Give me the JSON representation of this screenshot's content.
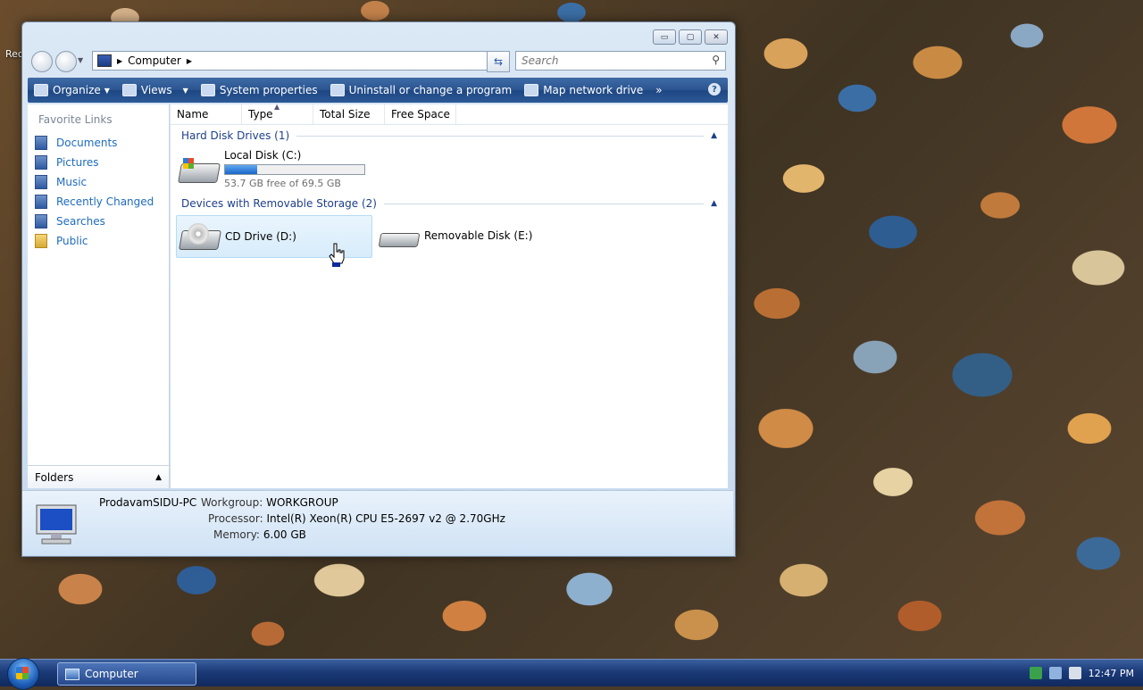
{
  "desktop": {
    "label_fragment": "Rec"
  },
  "window": {
    "caption": {
      "minimize": "▭",
      "maximize": "▢",
      "close": "✕"
    },
    "address": {
      "crumbs": [
        "Computer"
      ]
    },
    "search": {
      "placeholder": "Search"
    },
    "toolbar": {
      "items": [
        {
          "label": "Organize",
          "icon": "organize-icon"
        },
        {
          "label": "Views",
          "icon": "views-icon"
        },
        {
          "label": "System properties",
          "icon": "system-properties-icon"
        },
        {
          "label": "Uninstall or change a program",
          "icon": "uninstall-icon"
        },
        {
          "label": "Map network drive",
          "icon": "map-network-drive-icon"
        }
      ],
      "overflow": "»",
      "help": "?"
    },
    "nav": {
      "title": "Favorite Links",
      "items": [
        "Documents",
        "Pictures",
        "Music",
        "Recently Changed",
        "Searches",
        "Public"
      ],
      "folders_label": "Folders"
    },
    "columns": [
      "Name",
      "Type",
      "Total Size",
      "Free Space"
    ],
    "groups": [
      {
        "title": "Hard Disk Drives (1)",
        "drives": [
          {
            "name": "Local Disk (C:)",
            "free_text": "53.7 GB free of 69.5 GB",
            "used_fraction": 0.23
          }
        ]
      },
      {
        "title": "Devices with Removable Storage (2)",
        "drives": [
          {
            "name": "CD Drive (D:)"
          },
          {
            "name": "Removable Disk (E:)"
          }
        ]
      }
    ],
    "details": {
      "computer_name": "ProdavamSIDU-PC",
      "workgroup_label": "Workgroup:",
      "workgroup": "WORKGROUP",
      "processor_label": "Processor:",
      "processor": "Intel(R) Xeon(R) CPU E5-2697 v2 @ 2.70GHz",
      "memory_label": "Memory:",
      "memory": "6.00 GB"
    }
  },
  "taskbar": {
    "task_label": "Computer",
    "clock": "12:47 PM"
  },
  "colors": {
    "accent": "#2a5490",
    "link": "#1e6bbf",
    "group": "#1e3f8a"
  }
}
